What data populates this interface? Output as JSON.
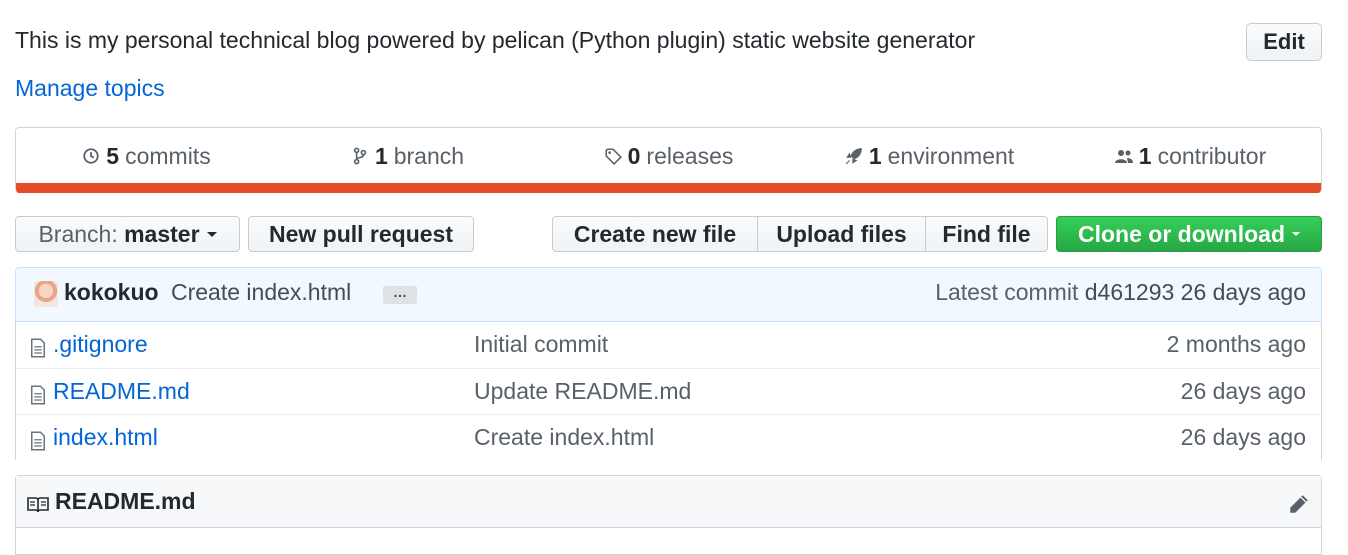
{
  "repo": {
    "description": "This is my personal technical blog powered by pelican (Python plugin) static website generator",
    "edit_label": "Edit",
    "manage_topics": "Manage topics"
  },
  "numbers": [
    {
      "icon": "history-icon",
      "count": "5",
      "label": "commits"
    },
    {
      "icon": "branch-icon",
      "count": "1",
      "label": "branch"
    },
    {
      "icon": "tag-icon",
      "count": "0",
      "label": "releases"
    },
    {
      "icon": "rocket-icon",
      "count": "1",
      "label": "environment"
    },
    {
      "icon": "people-icon",
      "count": "1",
      "label": "contributor"
    }
  ],
  "language_bar_color": "#e34c26",
  "toolbar": {
    "branch_prefix": "Branch:",
    "branch_name": "master",
    "new_pr": "New pull request",
    "create_file": "Create new file",
    "upload_files": "Upload files",
    "find_file": "Find file",
    "clone": "Clone or download"
  },
  "latest_commit": {
    "author": "kokokuo",
    "message": "Create index.html",
    "ellipsis": "…",
    "label": "Latest commit",
    "sha": "d461293",
    "age": "26 days ago"
  },
  "files": [
    {
      "name": ".gitignore",
      "message": "Initial commit",
      "age": "2 months ago"
    },
    {
      "name": "README.md",
      "message": "Update README.md",
      "age": "26 days ago"
    },
    {
      "name": "index.html",
      "message": "Create index.html",
      "age": "26 days ago"
    }
  ],
  "readme": {
    "title": "README.md"
  },
  "colors": {
    "link": "#0366d6",
    "clone_button": "#28a745",
    "commit_tease_bg": "#f1f8ff"
  }
}
